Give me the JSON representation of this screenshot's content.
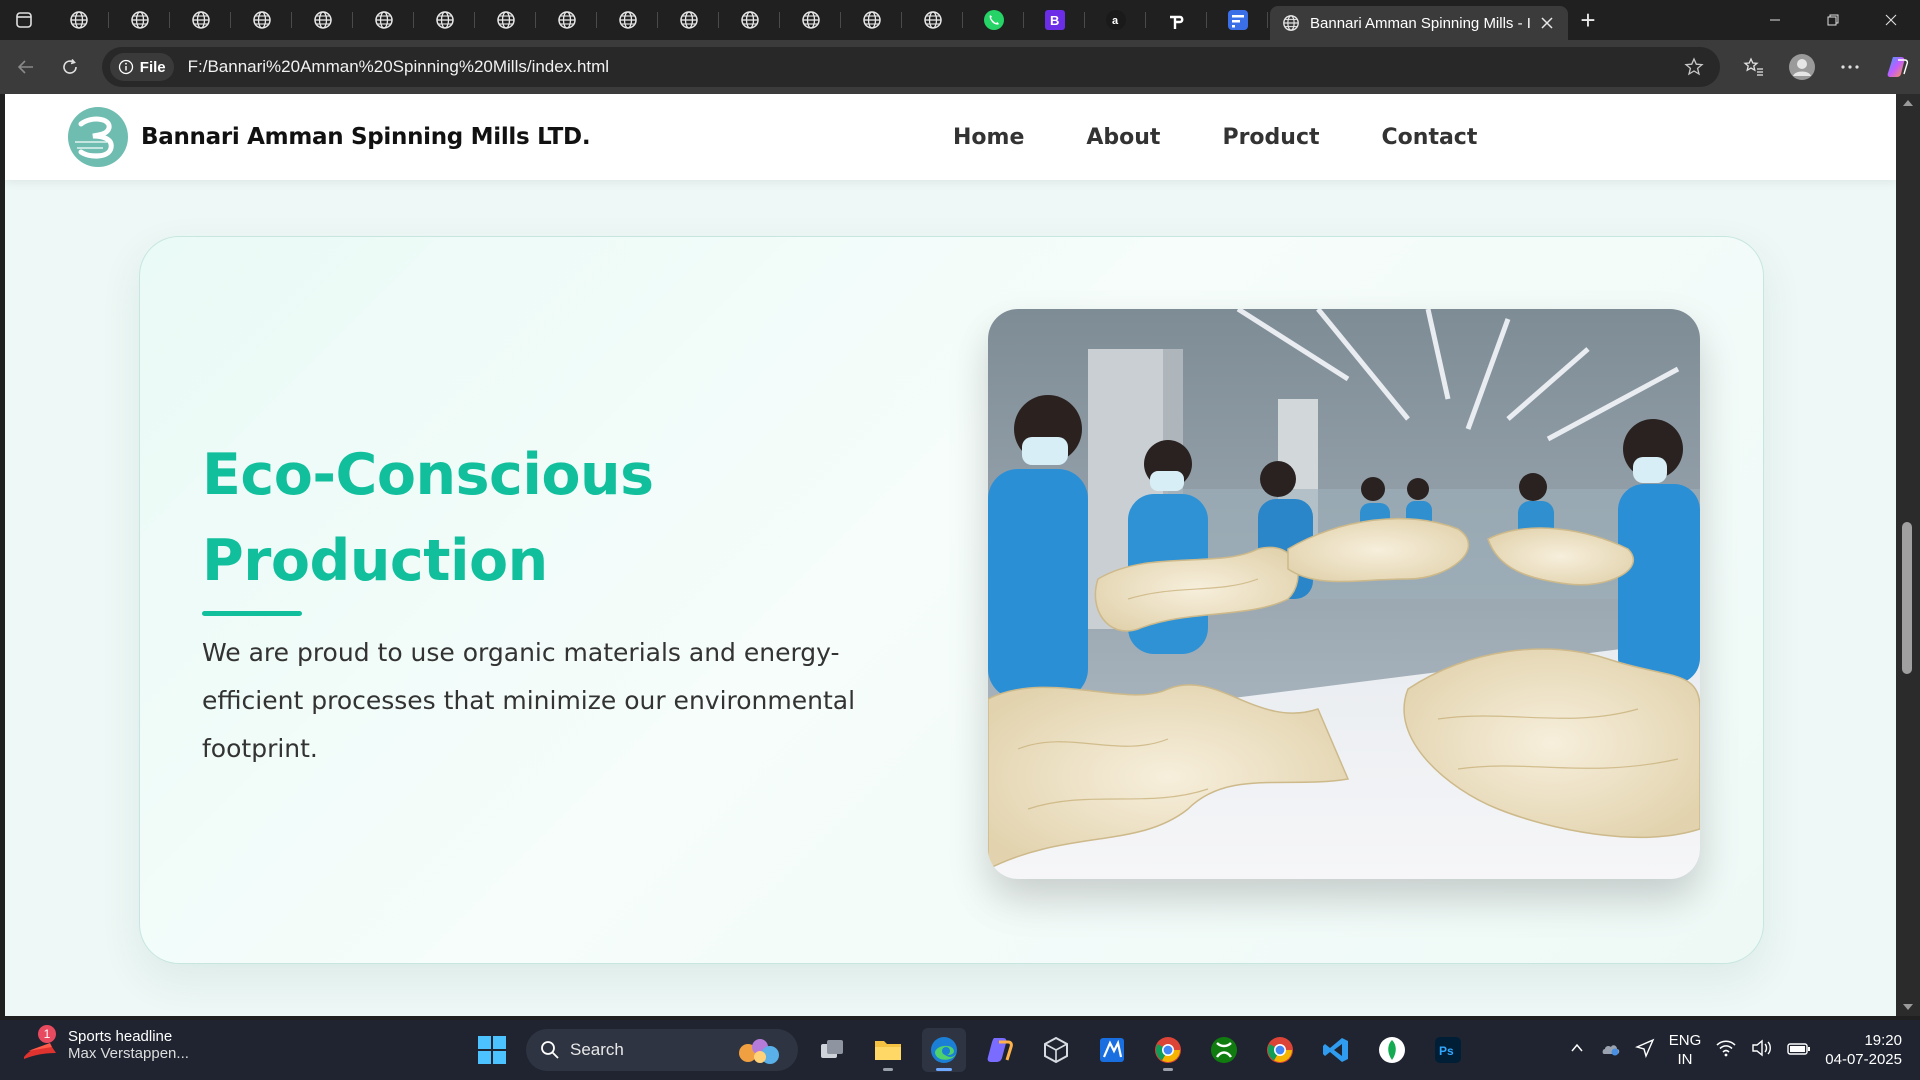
{
  "browser": {
    "pinned_tabs": [
      "globe",
      "globe",
      "globe",
      "globe",
      "globe",
      "globe",
      "globe",
      "globe",
      "globe",
      "globe",
      "globe",
      "globe",
      "globe",
      "globe",
      "globe",
      "whatsapp",
      "b-app",
      "a-app",
      "p-app",
      "forms-app"
    ],
    "active_tab": {
      "title": "Bannari Amman Spinning Mills - I",
      "icon": "globe-icon"
    },
    "new_tab_label": "+",
    "address": {
      "chip_label": "File",
      "url": "F:/Bannari%20Amman%20Spinning%20Mills/index.html"
    }
  },
  "site": {
    "brand": "Bannari Amman Spinning Mills LTD.",
    "nav": [
      "Home",
      "About",
      "Product",
      "Contact"
    ],
    "hero": {
      "title_line1": "Eco-Conscious",
      "title_line2": "Production",
      "text": "We are proud to use organic materials and energy-efficient processes that minimize our environmental footprint."
    },
    "accent_color": "#12bf9c"
  },
  "taskbar": {
    "widget_badge": "1",
    "widget_title": "Sports headline",
    "widget_sub": "Max Verstappen...",
    "search_label": "Search",
    "lang_top": "ENG",
    "lang_bottom": "IN",
    "time": "19:20",
    "date": "04-07-2025"
  }
}
